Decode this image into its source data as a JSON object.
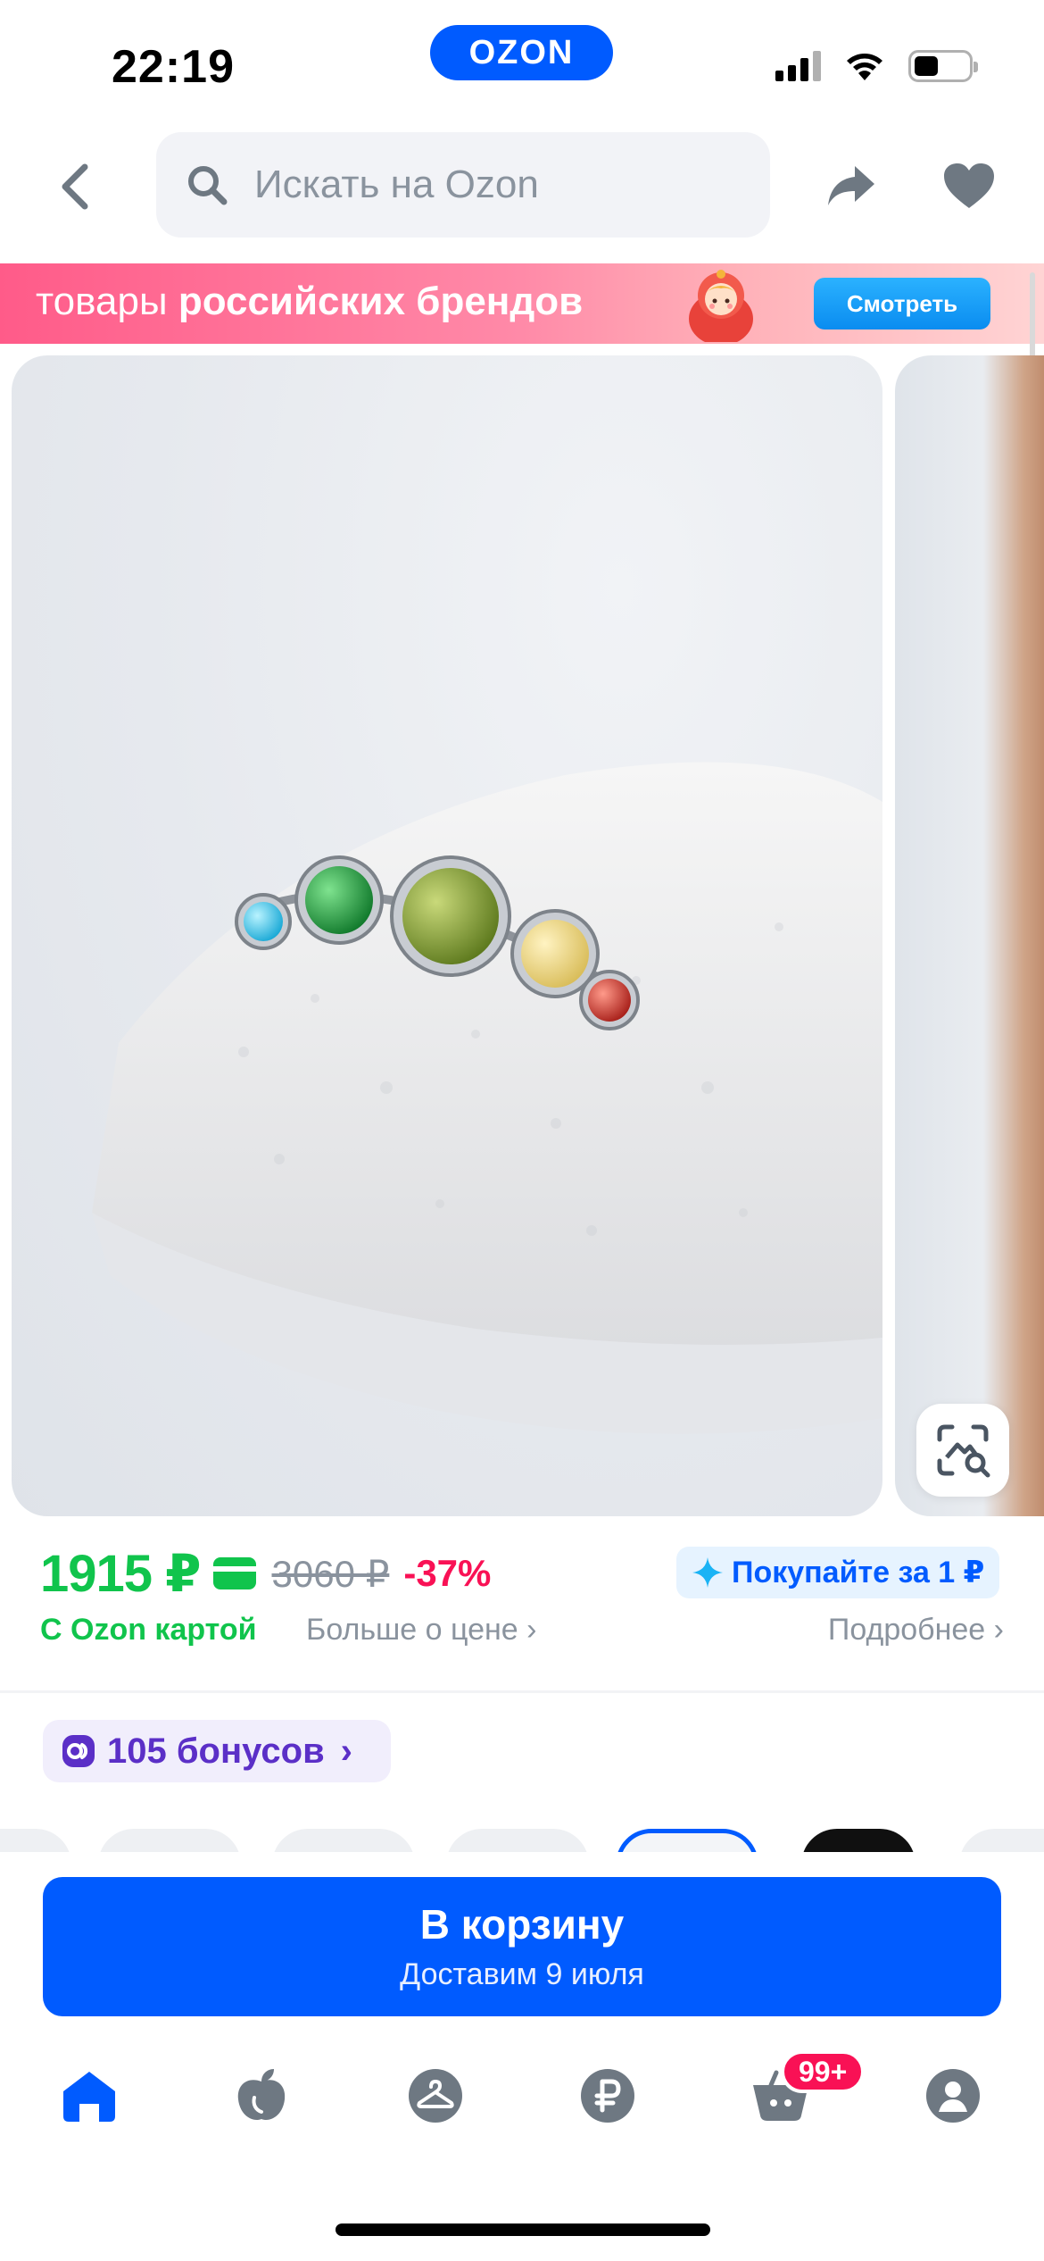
{
  "status_bar": {
    "time": "22:19",
    "app_pill": "OZON",
    "icons": [
      "signal-icon",
      "wifi-icon",
      "battery-icon"
    ]
  },
  "header": {
    "search_placeholder": "Искать на Ozon",
    "icons": [
      "back-icon",
      "search-icon",
      "share-icon",
      "heart-icon"
    ]
  },
  "banner": {
    "text_regular": "товары ",
    "text_bold": "российских брендов",
    "button_label": "Смотреть"
  },
  "product": {
    "price": "1915 ₽",
    "old_price": "3060 ₽",
    "discount": "-37%",
    "ozon_card_label": "С Ozon картой",
    "more_about_price": "Больше о цене",
    "buy_badge": "Покупайте за 1 ₽",
    "details": "Подробнее",
    "bonus": "105 бонусов",
    "colors": {
      "price_green": "#10c44c",
      "discount_pink": "#f91155",
      "brand_blue": "#005bff"
    }
  },
  "cart_button": {
    "title": "В корзину",
    "subtitle": "Доставим 9 июля"
  },
  "tabbar": {
    "items": [
      "home-icon",
      "fresh-icon",
      "hanger-icon",
      "ruble-icon",
      "cart-icon",
      "profile-icon"
    ],
    "cart_badge": "99+"
  }
}
